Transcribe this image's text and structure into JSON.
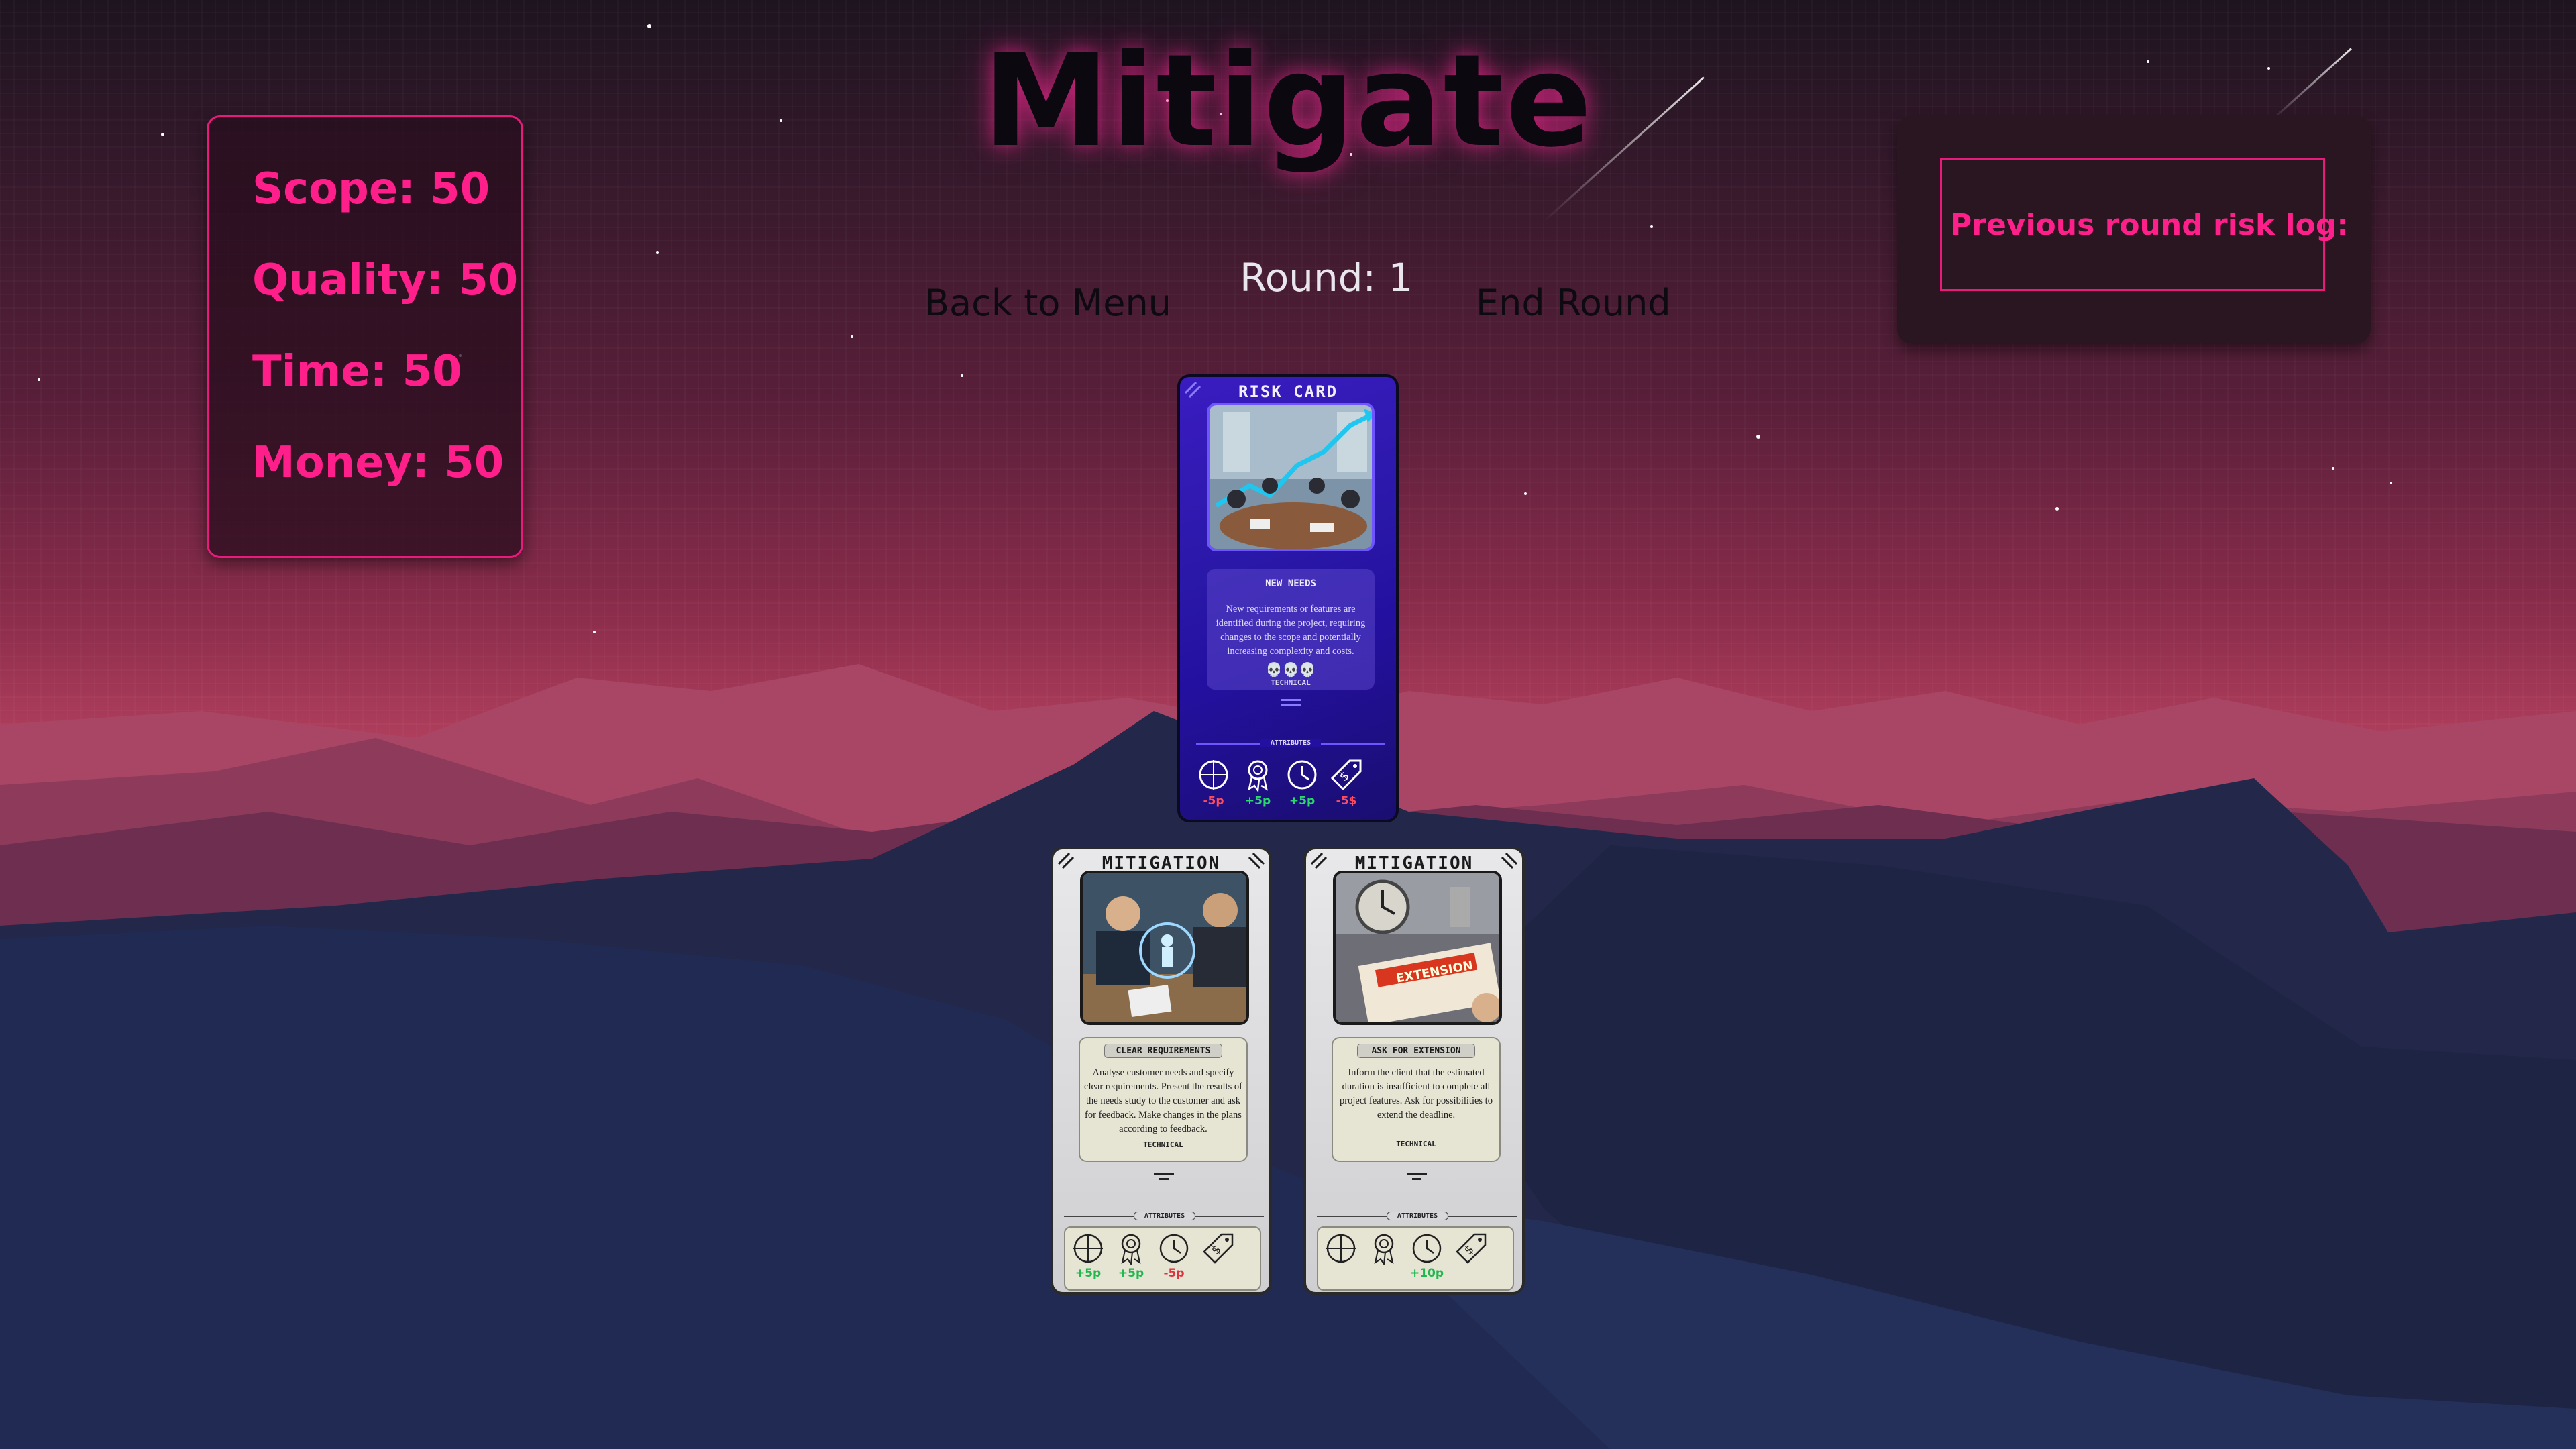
{
  "game": {
    "title": "Mitigate",
    "round_label": "Round: 1"
  },
  "stats": {
    "scope": "Scope: 50",
    "quality": "Quality: 50",
    "time": "Time: 50",
    "money": "Money: 50"
  },
  "risk_log": {
    "label": "Previous round risk log:"
  },
  "buttons": {
    "back": "Back to Menu",
    "end_round": "End Round"
  },
  "risk_card": {
    "header": "RISK CARD",
    "name": "NEW NEEDS",
    "description": "New requirements or features are identified during the project, requiring changes to the scope and potentially increasing complexity and costs.",
    "severity": "💀💀💀",
    "category": "TECHNICAL",
    "attributes_title": "ATTRIBUTES",
    "attributes": [
      {
        "icon": "scope-icon",
        "value": "-5p",
        "color": "#ff4b5c"
      },
      {
        "icon": "quality-icon",
        "value": "+5p",
        "color": "#2bd96b"
      },
      {
        "icon": "time-icon",
        "value": "+5p",
        "color": "#2bd96b"
      },
      {
        "icon": "money-icon",
        "value": "-5$",
        "color": "#ff4b5c"
      }
    ]
  },
  "mitigation_cards": [
    {
      "header": "MITIGATION",
      "name": "CLEAR REQUIREMENTS",
      "description": "Analyse customer needs and specify clear requirements. Present the results of the needs study to the customer and ask for feedback. Make changes in the plans according to feedback.",
      "category": "TECHNICAL",
      "attributes_title": "ATTRIBUTES",
      "attributes": [
        {
          "icon": "scope-icon",
          "value": "+5p",
          "color": "#1fb84f"
        },
        {
          "icon": "quality-icon",
          "value": "+5p",
          "color": "#1fb84f"
        },
        {
          "icon": "time-icon",
          "value": "-5p",
          "color": "#e0313f"
        },
        {
          "icon": "money-icon",
          "value": "",
          "color": "#222222"
        }
      ]
    },
    {
      "header": "MITIGATION",
      "name": "ASK FOR EXTENSION",
      "description": "Inform the client that the estimated duration is insufficient to complete all project features. Ask for possibilities to extend the deadline.",
      "category": "TECHNICAL",
      "attributes_title": "ATTRIBUTES",
      "attributes": [
        {
          "icon": "scope-icon",
          "value": "",
          "color": "#222222"
        },
        {
          "icon": "quality-icon",
          "value": "",
          "color": "#222222"
        },
        {
          "icon": "time-icon",
          "value": "+10p",
          "color": "#1fb84f"
        },
        {
          "icon": "money-icon",
          "value": "",
          "color": "#222222"
        }
      ]
    }
  ],
  "colors": {
    "accent": "#ff1f8b",
    "risk_card": "#2a18a8"
  }
}
